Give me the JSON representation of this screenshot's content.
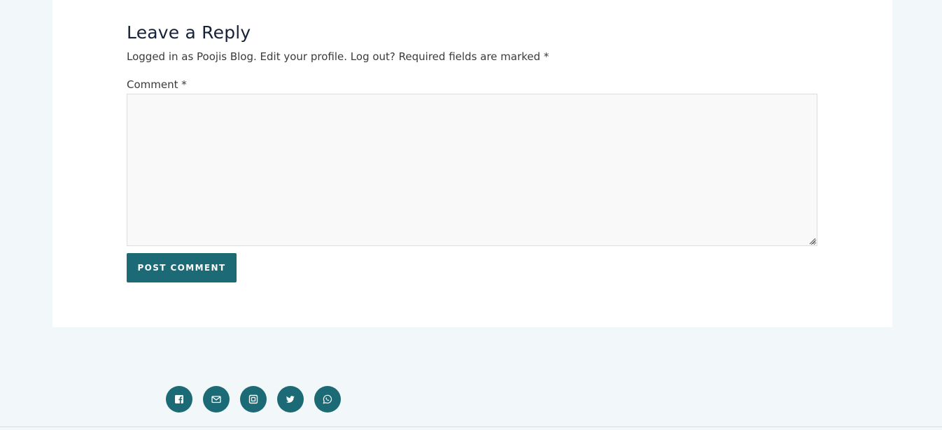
{
  "reply": {
    "title": "Leave a Reply",
    "logged_in_prefix": "Logged in as Poojis Blog.",
    "edit_profile_link": "Edit your profile.",
    "logout_link": "Log out?",
    "required_note": "Required fields are marked *",
    "comment_label": "Comment *",
    "comment_value": "",
    "submit_label": "POST COMMENT"
  },
  "social": [
    {
      "icon": "facebook-icon"
    },
    {
      "icon": "mail-icon"
    },
    {
      "icon": "instagram-icon"
    },
    {
      "icon": "twitter-icon"
    },
    {
      "icon": "whatsapp-icon"
    }
  ],
  "colors": {
    "accent": "#1b6a76",
    "page_background": "#f2f7f9",
    "card_background": "#ffffff",
    "heading": "#16213a"
  }
}
